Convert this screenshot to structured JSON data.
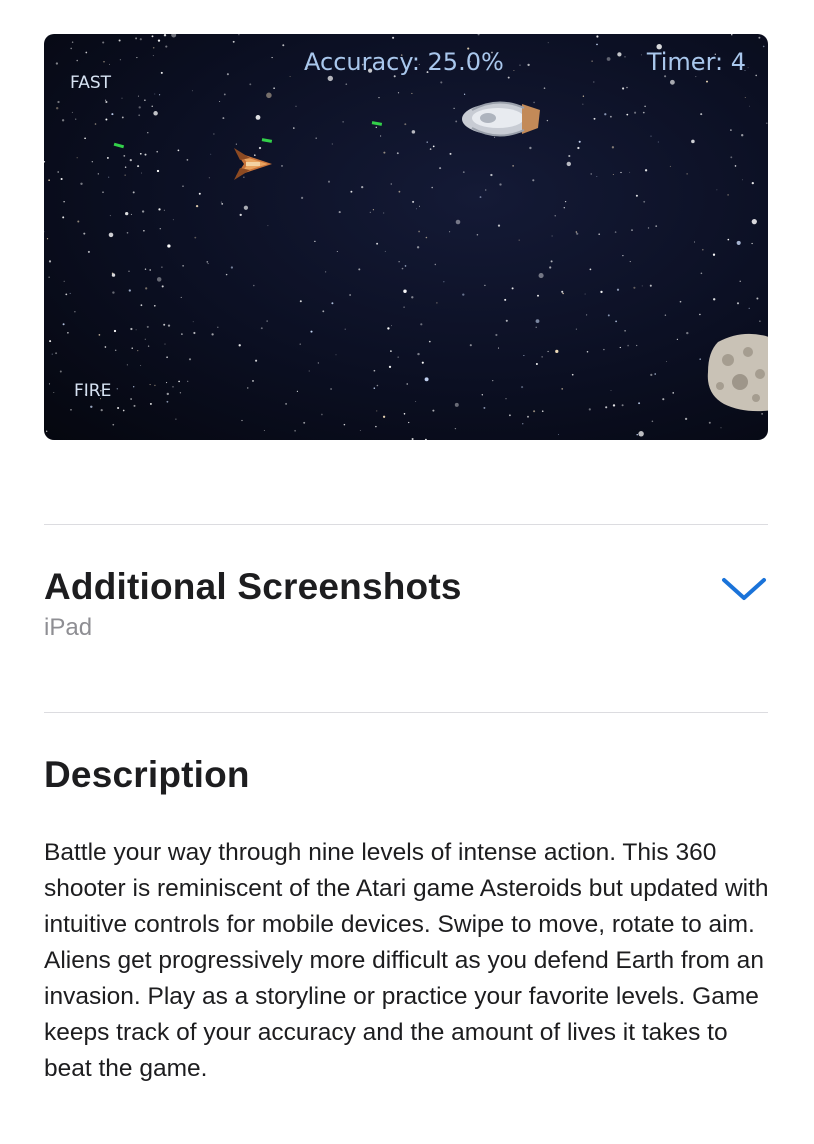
{
  "game": {
    "accuracy": "Accuracy: 25.0%",
    "timer": "Timer: 4",
    "fast_label": "FAST",
    "fire_label": "FIRE"
  },
  "additional": {
    "title": "Additional Screenshots",
    "subtitle": "iPad"
  },
  "description": {
    "title": "Description",
    "text": "Battle your way through nine levels of intense action. This 360 shooter is reminiscent of the Atari game Asteroids but updated with intuitive controls for mobile devices. Swipe to move, rotate to aim. Aliens get progressively more difficult as you defend Earth from an invasion. Play as a storyline or practice your favorite levels. Game keeps track of your accuracy and the amount of lives it takes to beat the game."
  },
  "colors": {
    "accent": "#1a73d9",
    "hud_text": "#a9c7ec",
    "laser": "#33d14a"
  },
  "icons": {
    "expand": "chevron-down-icon"
  }
}
